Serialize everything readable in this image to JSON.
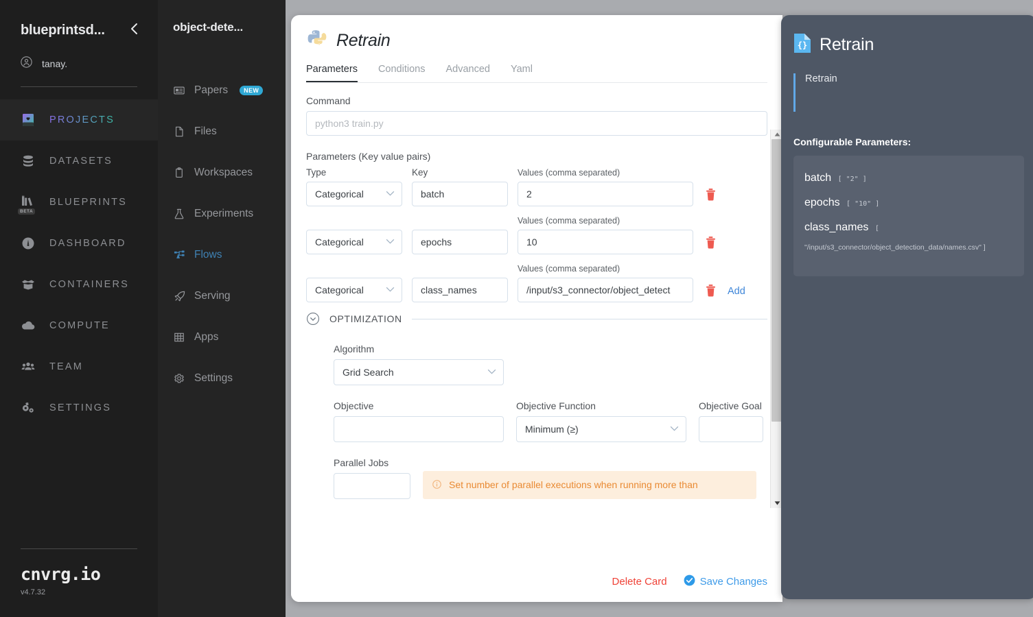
{
  "sidebar": {
    "org_name": "blueprintsd...",
    "collapse_icon": "chevron-left-icon",
    "user_name": "tanay.",
    "items": [
      {
        "label": "PROJECTS",
        "icon": "book-heart-icon",
        "active": true
      },
      {
        "label": "DATASETS",
        "icon": "database-icon",
        "active": false
      },
      {
        "label": "BLUEPRINTS",
        "icon": "books-icon",
        "badge": "BETA",
        "active": false
      },
      {
        "label": "DASHBOARD",
        "icon": "gauge-icon",
        "active": false
      },
      {
        "label": "CONTAINERS",
        "icon": "box-open-icon",
        "active": false
      },
      {
        "label": "COMPUTE",
        "icon": "cloud-icon",
        "active": false
      },
      {
        "label": "TEAM",
        "icon": "people-icon",
        "active": false
      },
      {
        "label": "SETTINGS",
        "icon": "gears-icon",
        "active": false
      }
    ],
    "brand": "cnvrg.io",
    "version": "v4.7.32"
  },
  "project_nav": {
    "project_title": "object-dete...",
    "items": [
      {
        "label": "Papers",
        "icon": "article-icon",
        "badge": "NEW",
        "active": false
      },
      {
        "label": "Files",
        "icon": "file-icon",
        "active": false
      },
      {
        "label": "Workspaces",
        "icon": "clipboard-icon",
        "active": false
      },
      {
        "label": "Experiments",
        "icon": "flask-icon",
        "active": false
      },
      {
        "label": "Flows",
        "icon": "flow-icon",
        "active": true
      },
      {
        "label": "Serving",
        "icon": "rocket-icon",
        "active": false
      },
      {
        "label": "Apps",
        "icon": "grid-icon",
        "active": false
      },
      {
        "label": "Settings",
        "icon": "gear-icon",
        "active": false
      }
    ]
  },
  "card": {
    "title": "Retrain",
    "title_icon": "python-icon",
    "tabs": [
      {
        "label": "Parameters",
        "active": true
      },
      {
        "label": "Conditions",
        "active": false
      },
      {
        "label": "Advanced",
        "active": false
      },
      {
        "label": "Yaml",
        "active": false
      }
    ],
    "command_label": "Command",
    "command_placeholder": "python3 train.py",
    "command_value": "",
    "params_section_label": "Parameters (Key value pairs)",
    "col_headers": {
      "type": "Type",
      "key": "Key",
      "values": "Values (comma separated)"
    },
    "params": [
      {
        "type": "Categorical",
        "key": "batch",
        "values": "2",
        "delete_icon": "trash-icon"
      },
      {
        "type": "Categorical",
        "key": "epochs",
        "values": "10",
        "delete_icon": "trash-icon"
      },
      {
        "type": "Categorical",
        "key": "class_names",
        "values": "/input/s3_connector/object_detect",
        "delete_icon": "trash-icon"
      }
    ],
    "add_label": "Add",
    "optimization": {
      "section_title": "OPTIMIZATION",
      "caret_icon": "chevron-down-circle-icon",
      "algorithm_label": "Algorithm",
      "algorithm_value": "Grid Search",
      "objective_label": "Objective",
      "objective_value": "",
      "objective_function_label": "Objective Function",
      "objective_function_value": "Minimum (≥)",
      "objective_goal_label": "Objective Goal",
      "objective_goal_value": "",
      "parallel_jobs_label": "Parallel Jobs",
      "parallel_jobs_value": "",
      "parallel_jobs_warning": "Set number of parallel executions when running more than",
      "warning_icon": "info-icon"
    },
    "footer": {
      "delete_label": "Delete Card",
      "save_label": "Save Changes",
      "save_icon": "check-circle-icon"
    },
    "scrollbar": {
      "up_arrow": "caret-up-icon",
      "down_arrow": "caret-down-icon"
    }
  },
  "right_panel": {
    "title": "Retrain",
    "title_icon": "json-file-icon",
    "description": "Retrain",
    "configurable_label": "Configurable Parameters:",
    "parameters": [
      {
        "name": "batch",
        "value": "[ \"2\" ]"
      },
      {
        "name": "epochs",
        "value": "[ \"10\" ]"
      },
      {
        "name": "class_names",
        "value": "[",
        "path": "\"/input/s3_connector/object_detection_data/names.csv\" ]"
      }
    ]
  },
  "colors": {
    "accent_blue": "#3d85d8",
    "danger_red": "#ef4136",
    "warning_orange": "#e98a33",
    "new_badge": "#2fa8d4",
    "right_panel_bg": "#4e5765"
  }
}
